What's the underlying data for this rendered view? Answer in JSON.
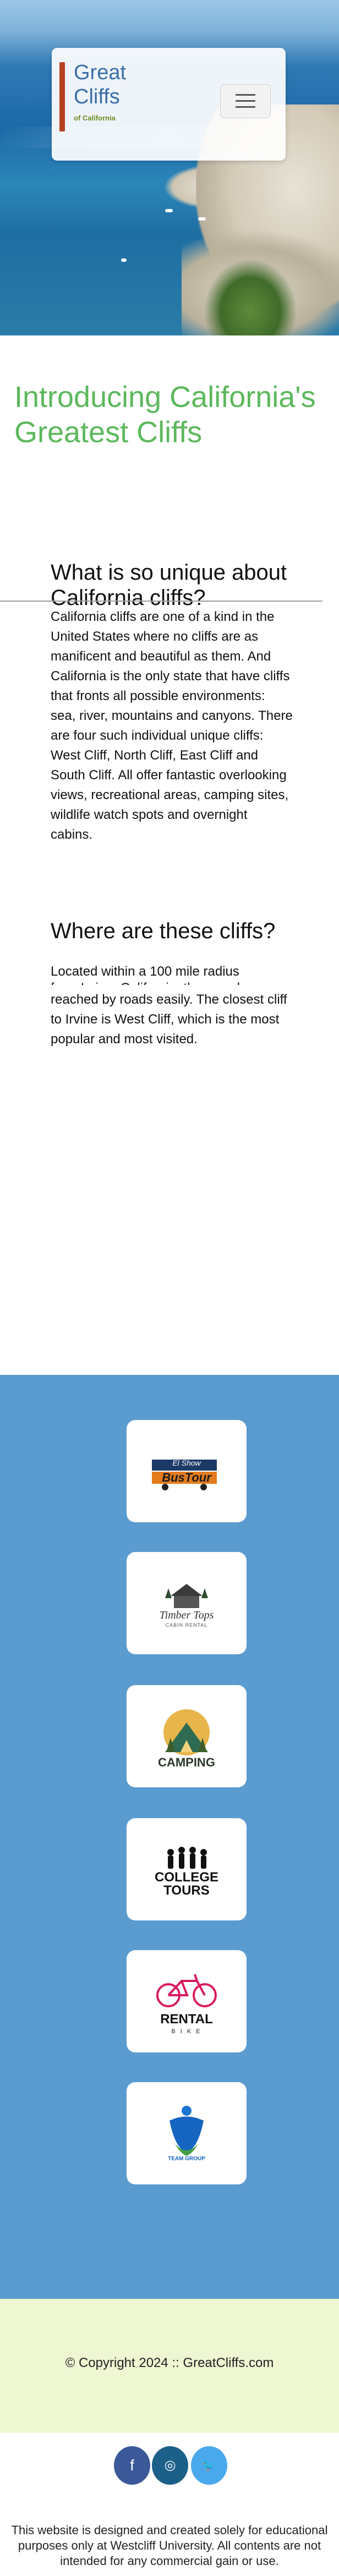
{
  "nav": {
    "logo_word1": "Great",
    "logo_word2": "Cliffs",
    "logo_sub": "of California",
    "menu_icon": "hamburger-menu-icon"
  },
  "intro": {
    "heading": "Introducing California's Greatest Cliffs"
  },
  "section_unique": {
    "heading": "What is so unique about California cliffs?",
    "body": "California cliffs are one of a kind in the United States where no cliffs are as manificent and beautiful as them. And California is the only state that have cliffs that fronts all possible environments: sea, river, mountains and canyons. There are four such individual unique cliffs: West Cliff, North Cliff, East Cliff and South Cliff. All offer fantastic overlooking views, recreational areas, camping sites, wildlife watch spots and overnight cabins."
  },
  "section_where": {
    "heading": "Where are these cliffs?",
    "body_line1": "Located within a 100 mile radius",
    "body_line2": "from Irvine, California, they can be",
    "body_rest": "reached by roads easily. The closest cliff to Irvine is West Cliff, which is the most popular and most visited."
  },
  "partners": [
    {
      "name": "El Show Bus Tour",
      "icon": "bus-tour-logo-icon",
      "line1": "El Show",
      "line2": "BusTour"
    },
    {
      "name": "Timber Tops",
      "icon": "cabin-logo-icon",
      "line1": "Timber Tops",
      "line2": "CABIN RENTAL"
    },
    {
      "name": "Camping",
      "icon": "camping-tent-logo-icon",
      "line1": "CAMPING"
    },
    {
      "name": "College Tours",
      "icon": "hikers-logo-icon",
      "line1": "COLLEGE",
      "line2": "TOURS"
    },
    {
      "name": "Rental Bike",
      "icon": "bicycle-logo-icon",
      "line1": "RENTAL",
      "line2": "B I K E"
    },
    {
      "name": "Team Group",
      "icon": "team-group-logo-icon",
      "line1": "TEAM GROUP"
    }
  ],
  "footer": {
    "copyright": "© Copyright 2024 :: GreatCliffs.com",
    "social": [
      {
        "name": "facebook",
        "icon": "facebook-icon",
        "glyph": "f",
        "color": "#3b5998"
      },
      {
        "name": "instagram",
        "icon": "instagram-icon",
        "glyph": "◎",
        "color": "#1c5f88"
      },
      {
        "name": "twitter",
        "icon": "twitter-icon",
        "glyph": "🐦",
        "color": "#4aa8ec"
      }
    ],
    "disclaimer": "This website is designed and created solely for educational purposes only at Westcliff University. All contents are not intended for any commercial gain or use."
  },
  "colors": {
    "accent_green": "#5cb85c",
    "partners_bg": "#5a9bd0",
    "footer_bg": "#eef6d2"
  }
}
